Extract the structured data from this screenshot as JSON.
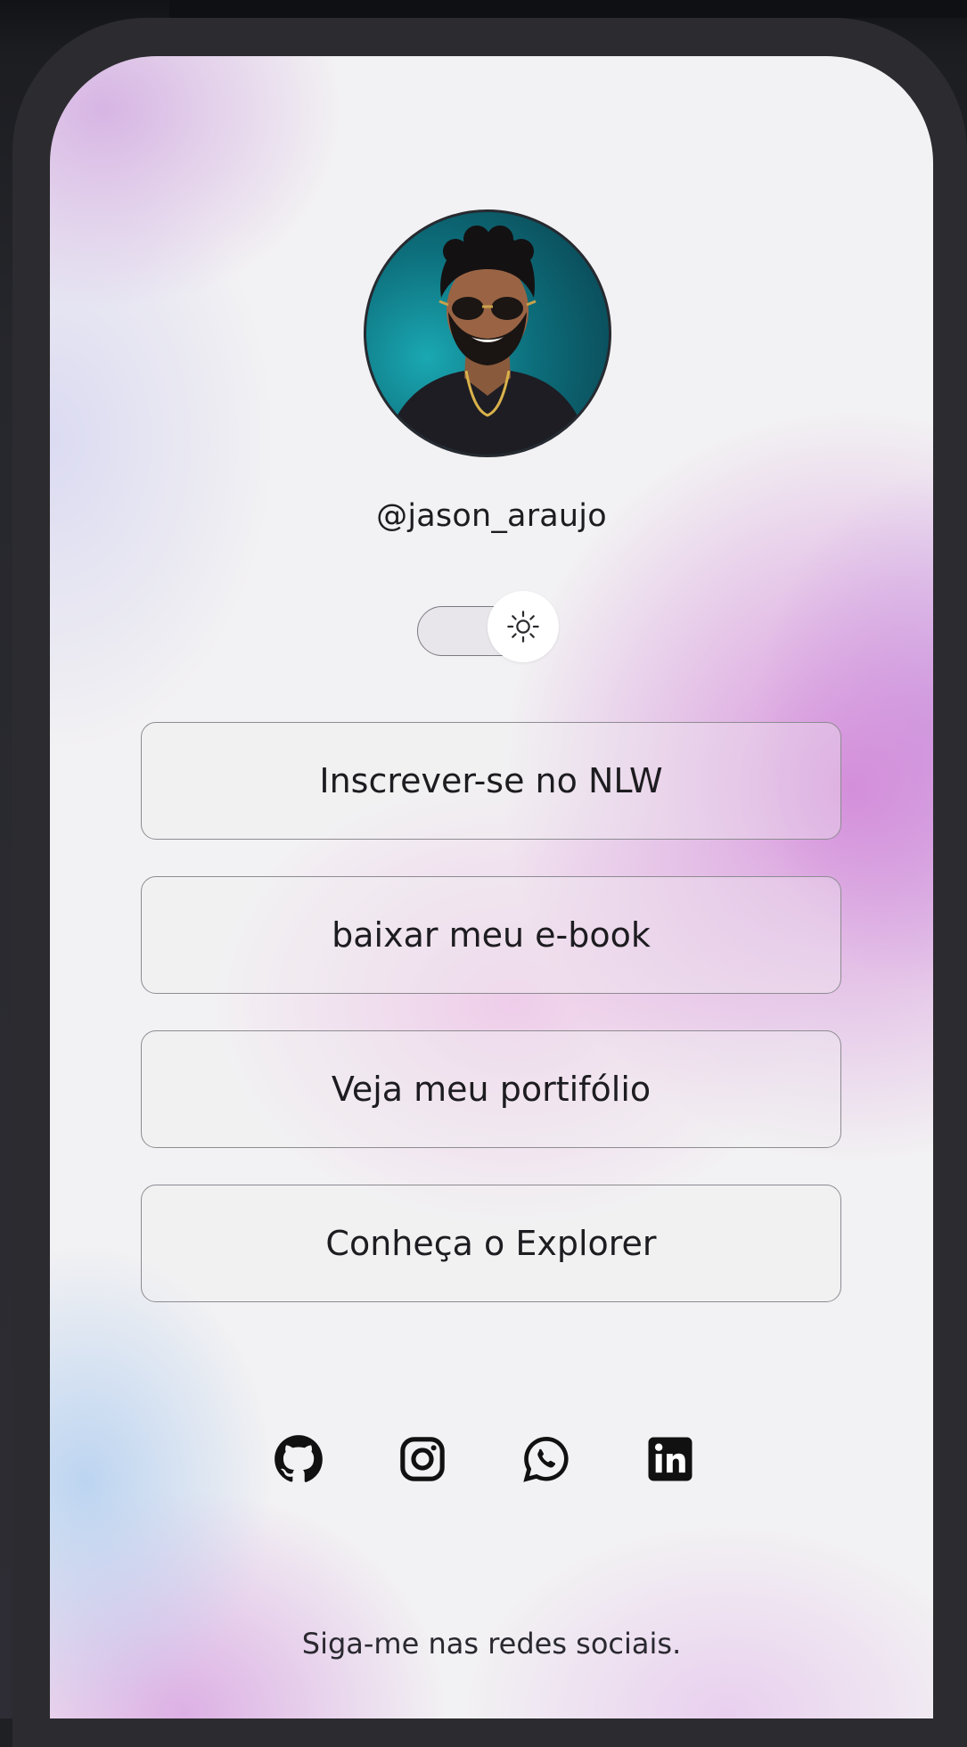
{
  "profile": {
    "username": "@jason_araujo",
    "avatar_icon": "profile-photo"
  },
  "theme_toggle": {
    "icon": "sun-icon",
    "state": "light"
  },
  "links": [
    {
      "label": "Inscrever-se no NLW"
    },
    {
      "label": "baixar meu e-book"
    },
    {
      "label": "Veja meu portifólio"
    },
    {
      "label": "Conheça o Explorer"
    }
  ],
  "social": [
    {
      "icon": "github-icon"
    },
    {
      "icon": "instagram-icon"
    },
    {
      "icon": "whatsapp-icon"
    },
    {
      "icon": "linkedin-icon"
    }
  ],
  "footer": {
    "text": "Siga-me nas redes sociais."
  },
  "colors": {
    "text": "#1d1c20",
    "button_border": "#8e8b92",
    "frame": "#2c2c30",
    "avatar_bg": "#0d6f7c"
  }
}
